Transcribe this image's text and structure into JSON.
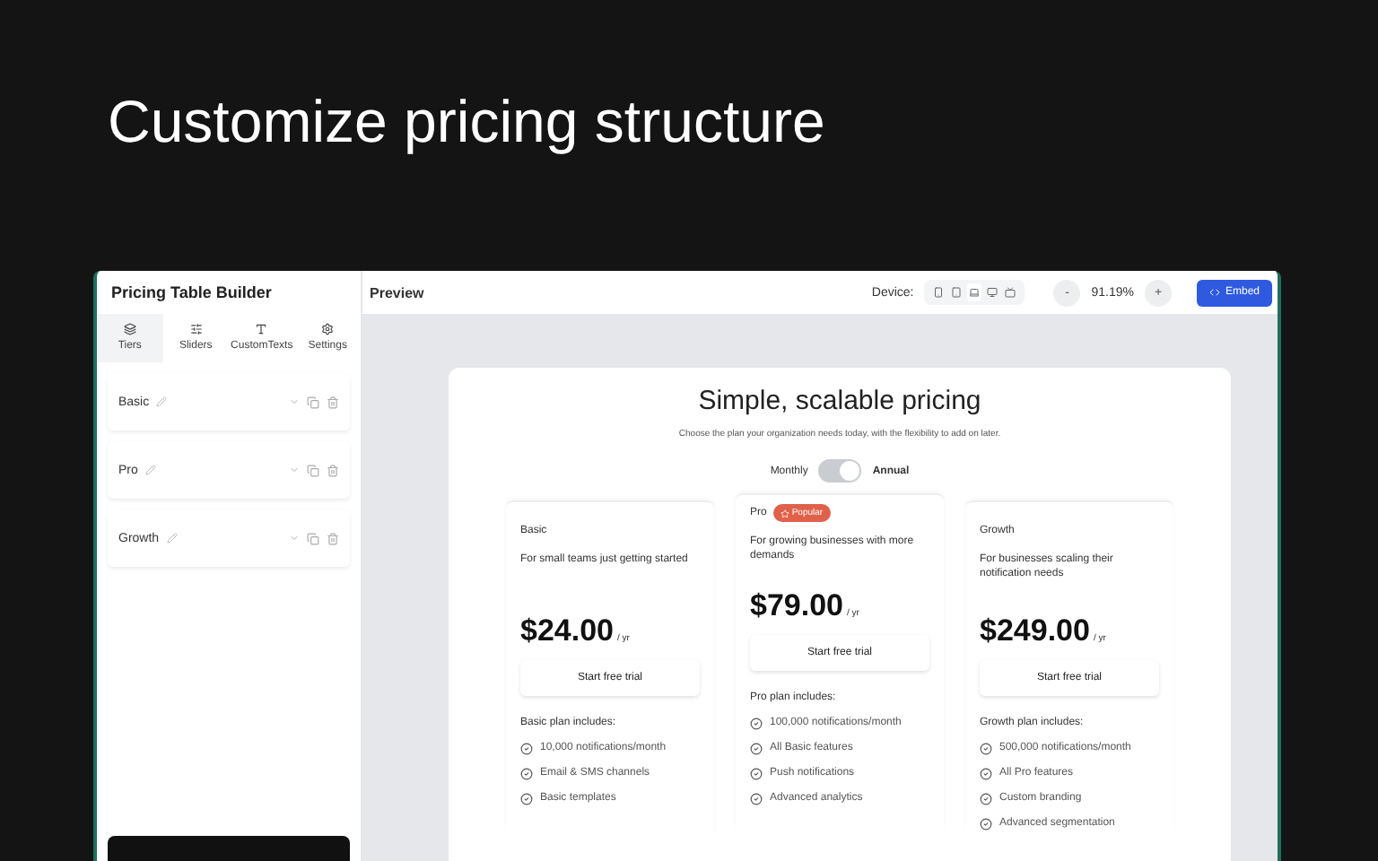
{
  "headline": "Customize pricing structure",
  "sidebar": {
    "title": "Pricing Table Builder",
    "tabs": [
      {
        "label": "Tiers",
        "selected": true
      },
      {
        "label": "Sliders",
        "selected": false
      },
      {
        "label": "CustomTexts",
        "selected": false
      },
      {
        "label": "Settings",
        "selected": false
      }
    ],
    "tiers": [
      {
        "name": "Basic"
      },
      {
        "name": "Pro"
      },
      {
        "name": "Growth"
      }
    ]
  },
  "preview": {
    "title": "Preview",
    "device_label": "Device:",
    "devices": [
      {
        "selected": false
      },
      {
        "selected": false
      },
      {
        "selected": true
      },
      {
        "selected": false
      },
      {
        "selected": false
      }
    ],
    "zoom_out": "-",
    "zoom": "91.19%",
    "zoom_in": "+",
    "embed": "Embed"
  },
  "pricing": {
    "title": "Simple, scalable pricing",
    "subtitle": "Choose the plan your organization needs today, with the flexibility to add on later.",
    "toggle": {
      "left": "Monthly",
      "right": "Annual",
      "on": true
    },
    "plans": [
      {
        "name": "Basic",
        "description": "For small teams just getting started",
        "price": "$24.00",
        "period": "/ yr",
        "cta": "Start free trial",
        "features_title": "Basic plan includes:",
        "features": [
          "10,000 notifications/month",
          "Email & SMS channels",
          "Basic templates"
        ]
      },
      {
        "name": "Pro",
        "badge": "Popular",
        "description": "For growing businesses with more demands",
        "price": "$79.00",
        "period": "/ yr",
        "cta": "Start free trial",
        "features_title": "Pro plan includes:",
        "features": [
          "100,000 notifications/month",
          "All Basic features",
          "Push notifications",
          "Advanced analytics"
        ]
      },
      {
        "name": "Growth",
        "description": "For businesses scaling their notification needs",
        "price": "$249.00",
        "period": "/ yr",
        "cta": "Start free trial",
        "features_title": "Growth plan includes:",
        "features": [
          "500,000 notifications/month",
          "All Pro features",
          "Custom branding",
          "Advanced segmentation"
        ]
      }
    ]
  }
}
